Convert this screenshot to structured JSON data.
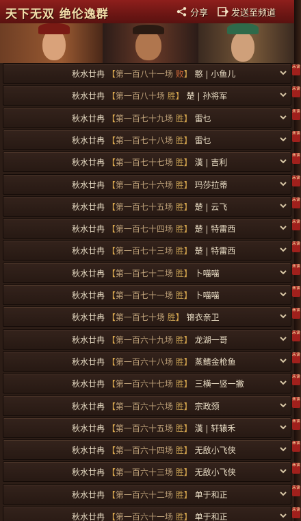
{
  "header": {
    "title": "天下无双 绝伦逸群",
    "share_label": "分享",
    "send_label": "发送至频道"
  },
  "rows": [
    {
      "name": "秋水廿冉",
      "bl": "【",
      "match": "第一百八十一场",
      "result": "败",
      "br": "】",
      "player": "憨 | 小鱼儿",
      "tag": "未读"
    },
    {
      "name": "秋水廿冉",
      "bl": "【",
      "match": "第一百八十场",
      "result": "胜",
      "br": "】",
      "player": "楚 | 孙将军",
      "tag": "未读"
    },
    {
      "name": "秋水廿冉",
      "bl": "【",
      "match": "第一百七十九场",
      "result": "胜",
      "br": "】",
      "player": "雷乜",
      "tag": "未读"
    },
    {
      "name": "秋水廿冉",
      "bl": "【",
      "match": "第一百七十八场",
      "result": "胜",
      "br": "】",
      "player": "雷乜",
      "tag": "未读"
    },
    {
      "name": "秋水廿冉",
      "bl": "【",
      "match": "第一百七十七场",
      "result": "胜",
      "br": "】",
      "player": "漢 | 吉利",
      "tag": "未读"
    },
    {
      "name": "秋水廿冉",
      "bl": "【",
      "match": "第一百七十六场",
      "result": "胜",
      "br": "】",
      "player": "玛莎拉蒂",
      "tag": "未读"
    },
    {
      "name": "秋水廿冉",
      "bl": "【",
      "match": "第一百七十五场",
      "result": "胜",
      "br": "】",
      "player": "楚 | 云飞",
      "tag": "未读"
    },
    {
      "name": "秋水廿冉",
      "bl": "【",
      "match": "第一百七十四场",
      "result": "胜",
      "br": "】",
      "player": "楚 | 特雷西",
      "tag": "未读"
    },
    {
      "name": "秋水廿冉",
      "bl": "【",
      "match": "第一百七十三场",
      "result": "胜",
      "br": "】",
      "player": "楚 | 特雷西",
      "tag": "未读"
    },
    {
      "name": "秋水廿冉",
      "bl": "【",
      "match": "第一百七十二场",
      "result": "胜",
      "br": "】",
      "player": "卜喵喵",
      "tag": "未读"
    },
    {
      "name": "秋水廿冉",
      "bl": "【",
      "match": "第一百七十一场",
      "result": "胜",
      "br": "】",
      "player": "卜喵喵",
      "tag": "未读"
    },
    {
      "name": "秋水廿冉",
      "bl": "【",
      "match": "第一百七十场",
      "result": "胜",
      "br": "】",
      "player": "锦衣亲卫",
      "tag": "未读"
    },
    {
      "name": "秋水廿冉",
      "bl": "【",
      "match": "第一百六十九场",
      "result": "胜",
      "br": "】",
      "player": "龙湖一哥",
      "tag": "未读"
    },
    {
      "name": "秋水廿冉",
      "bl": "【",
      "match": "第一百六十八场",
      "result": "胜",
      "br": "】",
      "player": "蒸鳍金枪鱼",
      "tag": "未读"
    },
    {
      "name": "秋水廿冉",
      "bl": "【",
      "match": "第一百六十七场",
      "result": "胜",
      "br": "】",
      "player": "三横一竖一撇",
      "tag": "未读"
    },
    {
      "name": "秋水廿冉",
      "bl": "【",
      "match": "第一百六十六场",
      "result": "胜",
      "br": "】",
      "player": "宗政颈",
      "tag": "未读"
    },
    {
      "name": "秋水廿冉",
      "bl": "【",
      "match": "第一百六十五场",
      "result": "胜",
      "br": "】",
      "player": "漢 | 轩辕禾",
      "tag": "未读"
    },
    {
      "name": "秋水廿冉",
      "bl": "【",
      "match": "第一百六十四场",
      "result": "胜",
      "br": "】",
      "player": "无敌小飞侠",
      "tag": "未读"
    },
    {
      "name": "秋水廿冉",
      "bl": "【",
      "match": "第一百六十三场",
      "result": "胜",
      "br": "】",
      "player": "无敌小飞侠",
      "tag": "未读"
    },
    {
      "name": "秋水廿冉",
      "bl": "【",
      "match": "第一百六十二场",
      "result": "胜",
      "br": "】",
      "player": "单于和正",
      "tag": "未读"
    },
    {
      "name": "秋水廿冉",
      "bl": "【",
      "match": "第一百六十一场",
      "result": "胜",
      "br": "】",
      "player": "单于和正",
      "tag": "未读"
    }
  ]
}
